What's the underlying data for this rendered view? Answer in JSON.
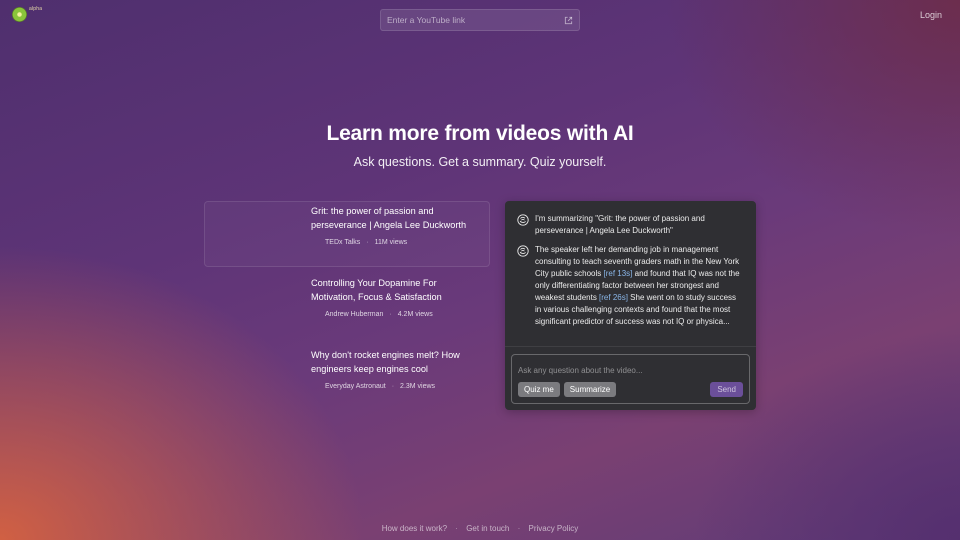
{
  "brand": {
    "badge": "alpha"
  },
  "header": {
    "url_placeholder": "Enter a YouTube link",
    "login_label": "Login"
  },
  "hero": {
    "title": "Learn more from videos with AI",
    "subtitle": "Ask questions. Get a summary. Quiz yourself."
  },
  "videos": [
    {
      "title": "Grit: the power of passion and perseverance | Angela Lee Duckworth",
      "channel": "TEDx Talks",
      "views": "11M views"
    },
    {
      "title": "Controlling Your Dopamine For Motivation, Focus & Satisfaction",
      "channel": "Andrew Huberman",
      "views": "4.2M views"
    },
    {
      "title": "Why don't rocket engines melt? How engineers keep engines cool",
      "channel": "Everyday Astronaut",
      "views": "2.3M views"
    }
  ],
  "chat": {
    "message_1": "I'm summarizing \"Grit: the power of passion and perseverance | Angela Lee Duckworth\"",
    "message_2": {
      "part_1": "The speaker left her demanding job in management consulting to teach seventh graders math in the New York City public schools ",
      "ref_1": "[ref 13s]",
      "part_2": " and found that IQ was not the only differentiating factor between her strongest and weakest students ",
      "ref_2": "[ref 26s]",
      "part_3": " She went on to study success in various challenging contexts and found that the most significant predictor of success was not IQ or physica..."
    },
    "input_placeholder": "Ask any question about the video...",
    "quiz_label": "Quiz me",
    "summarize_label": "Summarize",
    "send_label": "Send"
  },
  "footer": {
    "how_label": "How does it work?",
    "contact_label": "Get in touch",
    "privacy_label": "Privacy Policy",
    "separator": "·"
  },
  "colors": {
    "panel_bg": "#2f2f33",
    "ref_link": "#8ab6e8",
    "send_button": "#6b4f9a",
    "chip_bg": "#7b7b7f"
  }
}
